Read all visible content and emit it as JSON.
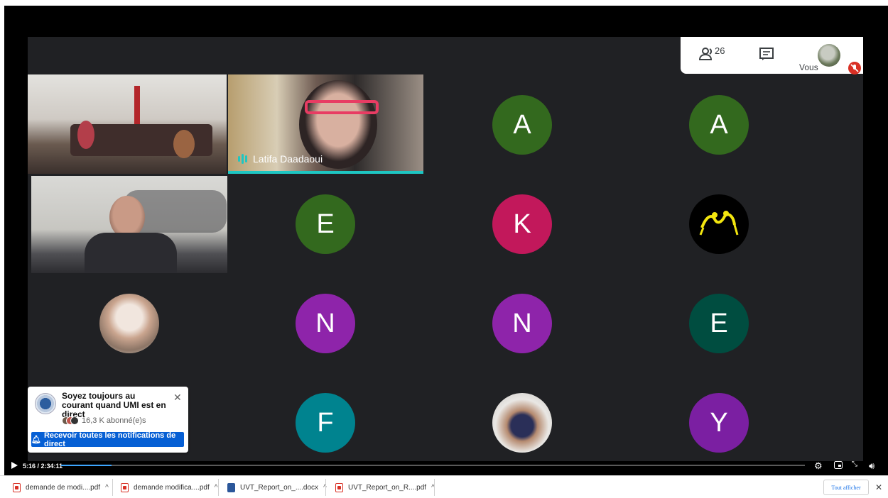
{
  "meeting": {
    "participant_count": "26",
    "self_label": "Vous",
    "icons": {
      "participants": "people-icon",
      "chat": "chat-icon",
      "mic": "mic-off-icon"
    }
  },
  "tiles": {
    "active_speaker_name": "Latifa Daadaoui"
  },
  "avatars": [
    {
      "letter": "A",
      "color": "#33691e"
    },
    {
      "letter": "A",
      "color": "#33691e"
    },
    {
      "letter": "E",
      "color": "#33691e"
    },
    {
      "letter": "K",
      "color": "#c2185b"
    },
    {
      "letter": "N",
      "color": "#8e24aa"
    },
    {
      "letter": "N",
      "color": "#8e24aa"
    },
    {
      "letter": "E",
      "color": "#004d40"
    },
    {
      "letter": "F",
      "color": "#00838f"
    },
    {
      "letter": "Y",
      "color": "#7b1fa2"
    }
  ],
  "notification": {
    "title": "Soyez toujours au courant quand UMI est en direct",
    "subscribers": "16,3 K abonné(e)s",
    "button_label": "Recevoir toutes les notifications de direct"
  },
  "player": {
    "time": "5:16 / 2:34:11",
    "progress": 0.034
  },
  "downloads": {
    "items": [
      {
        "label": "demande de modi....pdf",
        "type": "pdf"
      },
      {
        "label": "demande modifica....pdf",
        "type": "pdf"
      },
      {
        "label": "UVT_Report_on_....docx",
        "type": "docx"
      },
      {
        "label": "UVT_Report_on_R....pdf",
        "type": "pdf"
      }
    ],
    "show_all": "Tout afficher"
  },
  "colors": {
    "accent": "#1ec6c2",
    "youtube_blue": "#065fd4",
    "meet_bg": "#202124"
  }
}
